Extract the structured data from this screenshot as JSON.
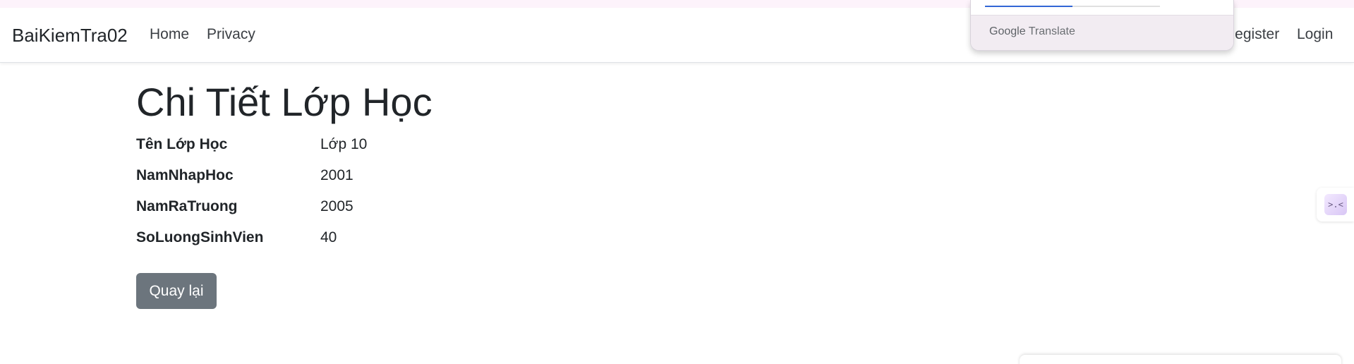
{
  "navbar": {
    "brand": "BaiKiemTra02",
    "links": [
      {
        "label": "Home"
      },
      {
        "label": "Privacy"
      },
      {
        "label": "Register"
      },
      {
        "label": "Login"
      }
    ]
  },
  "translate_popup": {
    "google": "Google",
    "translate": "Translate",
    "progress": 0.5
  },
  "page": {
    "title": "Chi Tiết Lớp Học",
    "details": [
      {
        "term": "Tên Lớp Học",
        "value": "Lớp 10"
      },
      {
        "term": "NamNhapHoc",
        "value": "2001"
      },
      {
        "term": "NamRaTruong",
        "value": "2005"
      },
      {
        "term": "SoLuongSinhVien",
        "value": "40"
      }
    ],
    "back_label": "Quay lại"
  },
  "side_widget": {
    "icon": "collapse-arrows-icon",
    "glyph": ">.<"
  },
  "colors": {
    "button_secondary": "#6c757d",
    "progress_blue": "#3367d6",
    "popup_footer": "#f2ecf2"
  }
}
